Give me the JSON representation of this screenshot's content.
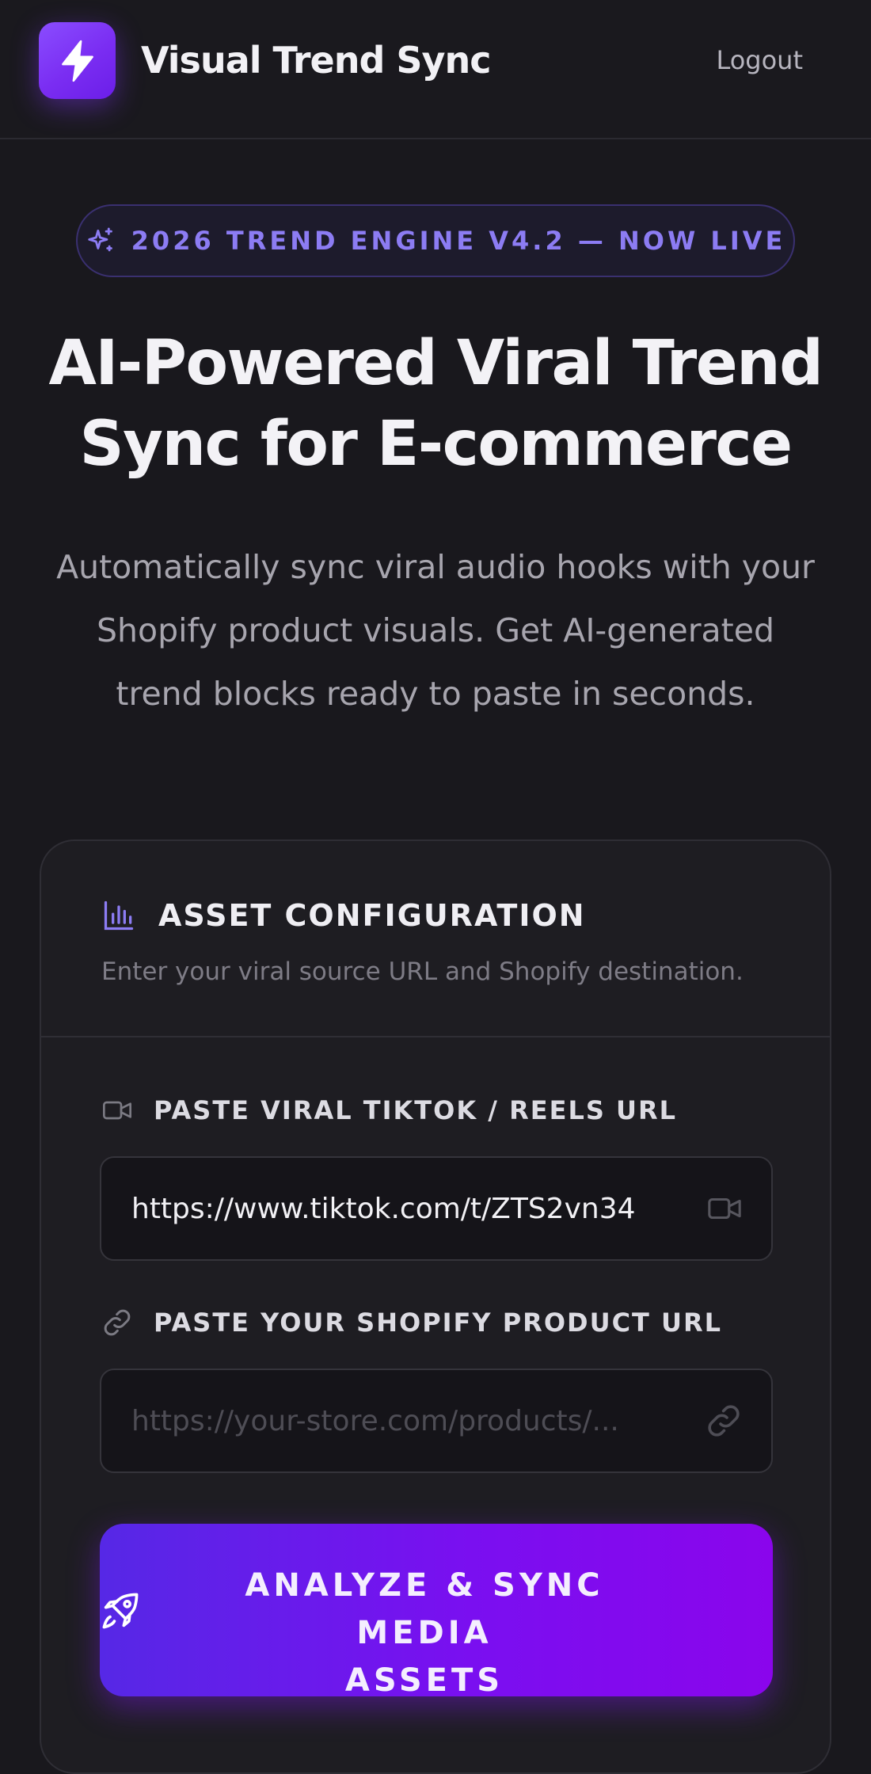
{
  "header": {
    "app_title": "Visual Trend Sync",
    "logout_label": "Logout",
    "logo_icon": "lightning-bolt-icon"
  },
  "hero": {
    "badge_icon": "sparkles-icon",
    "badge_text": "2026 TREND ENGINE V4.2 — NOW LIVE",
    "title_line1": "AI-Powered Viral Trend",
    "title_line2": "Sync for E-commerce",
    "subtitle_line1": "Automatically sync viral audio hooks with your",
    "subtitle_line2": "Shopify product visuals. Get AI-generated",
    "subtitle_line3": "trend blocks ready to paste in seconds."
  },
  "card": {
    "header_icon": "bar-chart-icon",
    "title": "ASSET CONFIGURATION",
    "description": "Enter your viral source URL and Shopify destination.",
    "fields": [
      {
        "label": "PASTE VIRAL TIKTOK / REELS URL",
        "icon": "video-icon",
        "value": "https://www.tiktok.com/t/ZTS2vn34",
        "placeholder": ""
      },
      {
        "label": "PASTE YOUR SHOPIFY PRODUCT URL",
        "icon": "link-icon",
        "value": "",
        "placeholder": "https://your-store.com/products/..."
      }
    ],
    "cta": {
      "icon": "rocket-icon",
      "label_line1": "ANALYZE & SYNC MEDIA",
      "label_line2": "ASSETS"
    }
  },
  "colors": {
    "background": "#19181d",
    "accent": "#7a2df2",
    "badge_text": "#8c7cf3",
    "cta_start": "#5628e6",
    "cta_end": "#8a05ec"
  }
}
